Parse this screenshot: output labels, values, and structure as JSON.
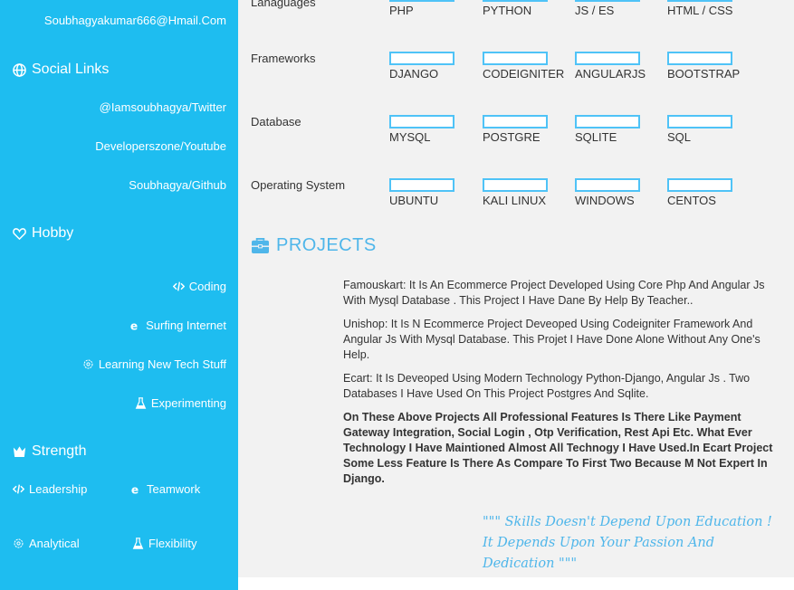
{
  "sidebar": {
    "email": "Soubhagyakumar666@Hmail.Com",
    "social_title": "Social Links",
    "social_links": [
      {
        "label": "@Iamsoubhagya/Twitter"
      },
      {
        "label": "Developerszone/Youtube"
      },
      {
        "label": "Soubhagya/Github"
      }
    ],
    "hobby_title": "Hobby",
    "hobbies": [
      {
        "label": "Coding",
        "icon": "code-icon"
      },
      {
        "label": "Surfing Internet",
        "icon": "internet-explorer-icon"
      },
      {
        "label": "Learning New Tech Stuff",
        "icon": "gear-icon"
      },
      {
        "label": "Experimenting",
        "icon": "flask-icon"
      }
    ],
    "strength_title": "Strength",
    "strengths": [
      {
        "label": "Leadership",
        "icon": "code-icon"
      },
      {
        "label": "Teamwork",
        "icon": "internet-explorer-icon"
      },
      {
        "label": "Analytical",
        "icon": "gear-icon"
      },
      {
        "label": "Flexibility",
        "icon": "flask-icon"
      }
    ]
  },
  "skills": {
    "rows": [
      {
        "label_line1": "",
        "label_line2": "Lanaguages",
        "items": [
          "PHP",
          "PYTHON",
          "JS / ES",
          "HTML / CSS"
        ]
      },
      {
        "label_line1": "Frameworks",
        "label_line2": "",
        "items": [
          "DJANGO",
          "CODEIGNITER",
          "ANGULARJS",
          "BOOTSTRAP"
        ]
      },
      {
        "label_line1": "Database",
        "label_line2": "",
        "items": [
          "MYSQL",
          "POSTGRE",
          "SQLITE",
          "SQL"
        ]
      },
      {
        "label_line1": "Operating System",
        "label_line2": "",
        "items": [
          "UBUNTU",
          "KALI LINUX",
          "WINDOWS",
          "CENTOS"
        ]
      }
    ]
  },
  "projects": {
    "title": "PROJECTS",
    "items": [
      "Famouskart: It Is An Ecommerce Project Developed Using Core Php And Angular Js With Mysql Database . This Project I Have Dane By Help By Teacher..",
      "Unishop: It Is N Ecommerce Project Deveoped Using Codeigniter Framework And Angular Js With Mysql Database. This Projet I Have Done Alone Without Any One's Help.",
      "Ecart: It Is Deveoped Using Modern Technology Python-Django, Angular Js . Two Databases I Have Used On This Project Postgres And Sqlite."
    ],
    "summary": "On These Above Projects All Professional Features Is There Like Payment Gateway Integration, Social Login , Otp Verification, Rest Api Etc. What Ever Technology I Have Maintioned Almost All Technogy I Have Used.In Ecart Project Some Less Feature Is There As Compare To First Two Because M Not Expert In Django."
  },
  "quote": "\"\"\" Skills Doesn't Depend Upon Education ! It Depends Upon Your Passion And Dedication \"\"\""
}
